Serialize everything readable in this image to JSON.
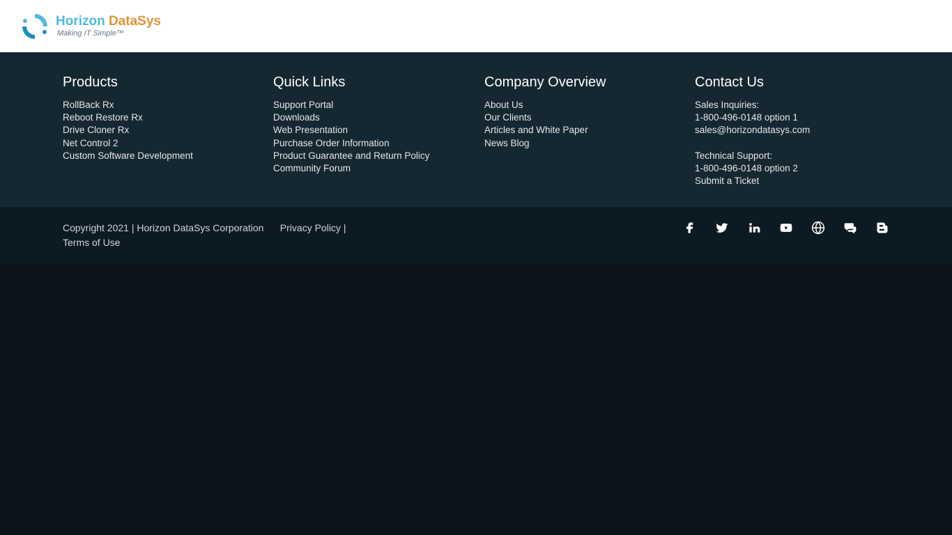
{
  "logo": {
    "name_part1": "Horizon ",
    "name_part2": "DataSys",
    "tagline": "Making IT Simple™"
  },
  "footer": {
    "products": {
      "title": "Products",
      "items": [
        "RollBack Rx",
        "Reboot Restore Rx",
        "Drive Cloner Rx",
        "Net Control 2",
        "Custom Software Development"
      ]
    },
    "quick_links": {
      "title": "Quick Links",
      "items": [
        "Support Portal",
        "Downloads",
        "Web Presentation",
        "Purchase Order Information",
        "Product Guarantee and Return Policy",
        "Community Forum"
      ]
    },
    "company": {
      "title": "Company Overview",
      "items": [
        "About Us",
        "Our Clients",
        "Articles and White Paper",
        "News Blog"
      ]
    },
    "contact": {
      "title": "Contact Us",
      "sales_label": "Sales Inquiries:",
      "sales_phone": "1-800-496-0148 option 1",
      "sales_email": "sales@horizondatasys.com",
      "support_label": "Technical Support:",
      "support_phone": "1-800-496-0148 option 2",
      "submit_ticket": "Submit a Ticket"
    }
  },
  "bottom": {
    "copyright": "Copyright 2021 | Horizon DataSys Corporation",
    "privacy": "Privacy Policy",
    "sep": " | ",
    "terms": "Terms of Use"
  },
  "social": {
    "facebook": "facebook",
    "twitter": "twitter",
    "linkedin": "linkedin",
    "youtube": "youtube",
    "web": "web",
    "chat": "chat",
    "blog": "blog"
  }
}
